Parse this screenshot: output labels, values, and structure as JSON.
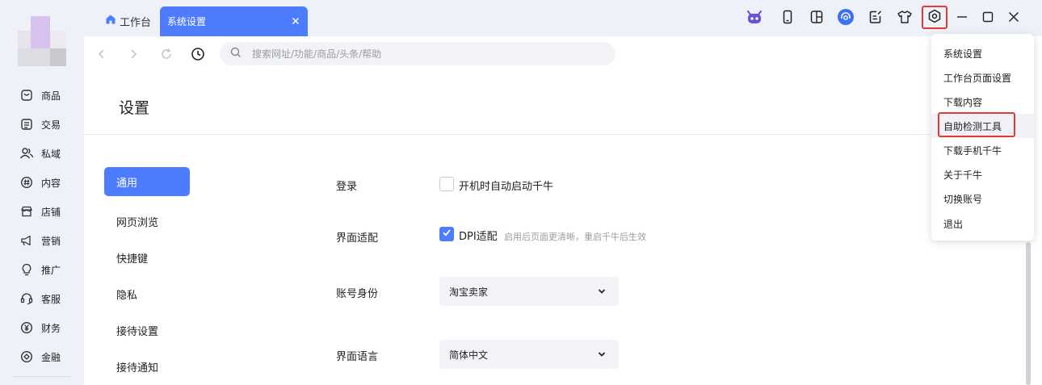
{
  "colors": {
    "accent": "#4d7cfe",
    "sidebar_bg": "#eef1f8",
    "highlight_red": "#e53935"
  },
  "sidebar": {
    "items": [
      {
        "label": "商品",
        "icon": "goods-icon"
      },
      {
        "label": "交易",
        "icon": "order-icon"
      },
      {
        "label": "私域",
        "icon": "users-icon"
      },
      {
        "label": "内容",
        "icon": "hashtag-icon"
      },
      {
        "label": "店铺",
        "icon": "store-icon"
      },
      {
        "label": "营销",
        "icon": "megaphone-icon"
      },
      {
        "label": "推广",
        "icon": "lightbulb-icon"
      },
      {
        "label": "客服",
        "icon": "headset-icon"
      },
      {
        "label": "财务",
        "icon": "yuan-icon"
      },
      {
        "label": "金融",
        "icon": "finance-icon"
      }
    ]
  },
  "tabs": {
    "home_label": "工作台",
    "active_label": "系统设置"
  },
  "toolbar": {
    "icons": [
      "robot-icon",
      "phone-icon",
      "notebook-icon",
      "headset-circle-icon",
      "edit-list-icon",
      "tshirt-icon",
      "settings-icon"
    ]
  },
  "search": {
    "placeholder": "搜索网址/功能/商品/头条/帮助"
  },
  "settings": {
    "title": "设置",
    "subnav": [
      "通用",
      "网页浏览",
      "快捷键",
      "隐私",
      "接待设置",
      "接待通知"
    ],
    "active_subnav": "通用",
    "login": {
      "label": "登录",
      "checkbox_label": "开机时自动启动千牛",
      "checked": false
    },
    "display": {
      "label": "界面适配",
      "checkbox_label": "DPI适配",
      "hint": "启用后页面更清晰，重启千牛后生效",
      "checked": true
    },
    "account": {
      "label": "账号身份",
      "value": "淘宝卖家"
    },
    "language": {
      "label": "界面语言",
      "value": "简体中文"
    }
  },
  "menu": {
    "items": [
      "系统设置",
      "工作台页面设置",
      "下载内容",
      "自助检测工具",
      "下载手机千牛",
      "关于千牛",
      "切换账号",
      "退出"
    ],
    "highlighted": "自助检测工具"
  }
}
